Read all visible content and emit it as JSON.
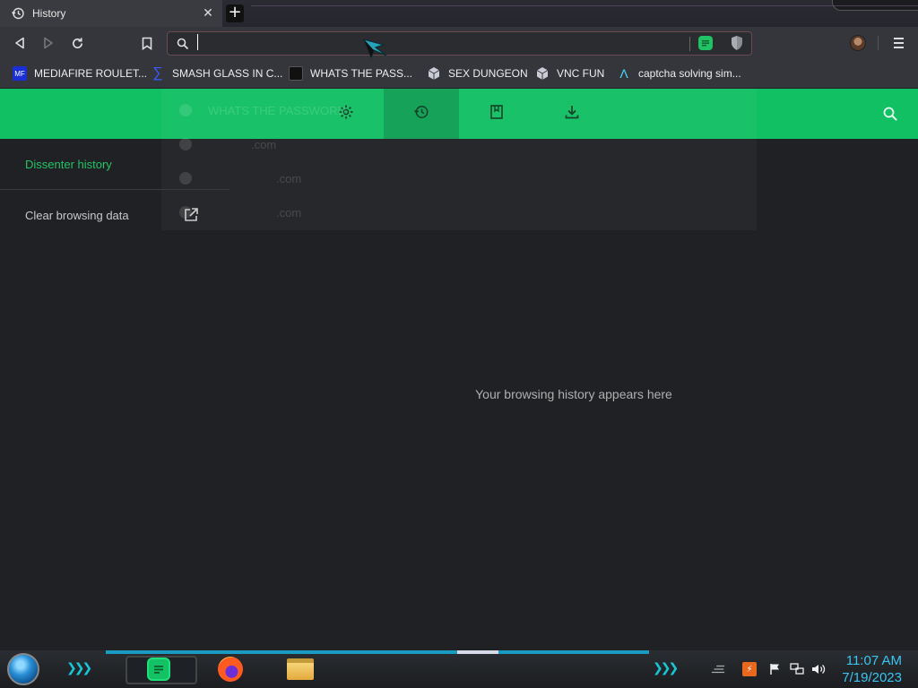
{
  "tab": {
    "title": "History",
    "close_glyph": "✕",
    "new_tab_glyph": "+"
  },
  "toolbar": {
    "address_value": "",
    "address_placeholder": ""
  },
  "bookmarks": [
    {
      "label": "MEDIAFIRE ROULET...",
      "icon": "mediafire-icon",
      "icon_text": "MF"
    },
    {
      "label": "SMASH GLASS IN C...",
      "icon": "sigma-icon",
      "icon_text": "∑"
    },
    {
      "label": "WHATS THE PASS...",
      "icon": "black-square-icon",
      "icon_text": ""
    },
    {
      "label": "SEX DUNGEON",
      "icon": "cube-icon",
      "icon_text": ""
    },
    {
      "label": "VNC FUN",
      "icon": "cube-icon",
      "icon_text": ""
    },
    {
      "label": "captcha solving sim...",
      "icon": "a-logo-icon",
      "icon_text": "Λ"
    }
  ],
  "header": {
    "tabs": [
      "settings-icon",
      "history-icon",
      "bookmarks-icon",
      "downloads-icon"
    ],
    "active_tab": "history-icon",
    "accent": "#11c063"
  },
  "sidebar": {
    "active_item": "Dissenter history",
    "clear_item": "Clear browsing data"
  },
  "dropdown_ghost": [
    {
      "text": "WHATS THE PASSWORD"
    },
    {
      "text": ".com"
    },
    {
      "text": ".com"
    },
    {
      "text": ".com"
    }
  ],
  "main": {
    "empty_message": "Your browsing history appears here"
  },
  "taskbar": {
    "time": "11:07 AM",
    "date": "7/19/2023",
    "apps": [
      "dissenter-icon",
      "firefox-icon",
      "file-explorer-icon"
    ]
  }
}
